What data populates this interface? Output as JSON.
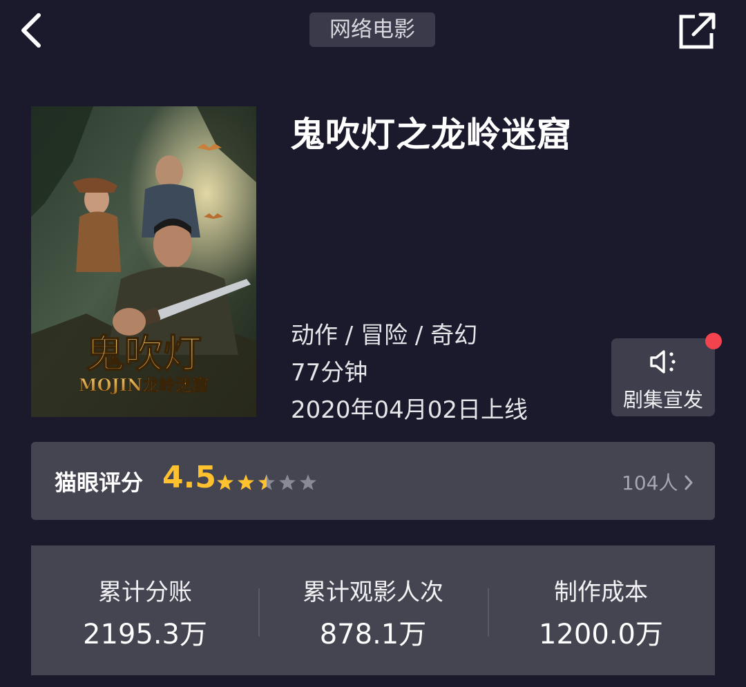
{
  "header": {
    "category_tag": "网络电影",
    "back_icon": "chevron-left-icon",
    "share_icon": "share-external-icon"
  },
  "movie": {
    "title": "鬼吹灯之龙岭迷窟",
    "genres": "动作 / 冒险 / 奇幻",
    "duration": "77分钟",
    "release": "2020年04月02日上线",
    "poster": {
      "title_art": "鬼吹灯",
      "subtitle_art": "MOJIN龙岭迷窟"
    }
  },
  "promo": {
    "label": "剧集宣发",
    "icon": "speaker-icon",
    "has_notification": true
  },
  "rating": {
    "label": "猫眼评分",
    "score": "4.5",
    "stars_filled": 2.5,
    "stars_total": 5,
    "count": "104人"
  },
  "stats": [
    {
      "label": "累计分账",
      "value": "2195.3万"
    },
    {
      "label": "累计观影人次",
      "value": "878.1万"
    },
    {
      "label": "制作成本",
      "value": "1200.0万"
    }
  ],
  "colors": {
    "background": "#1b1a2c",
    "card": "#454552",
    "score": "#ffc12e",
    "notification": "#f2434e"
  }
}
